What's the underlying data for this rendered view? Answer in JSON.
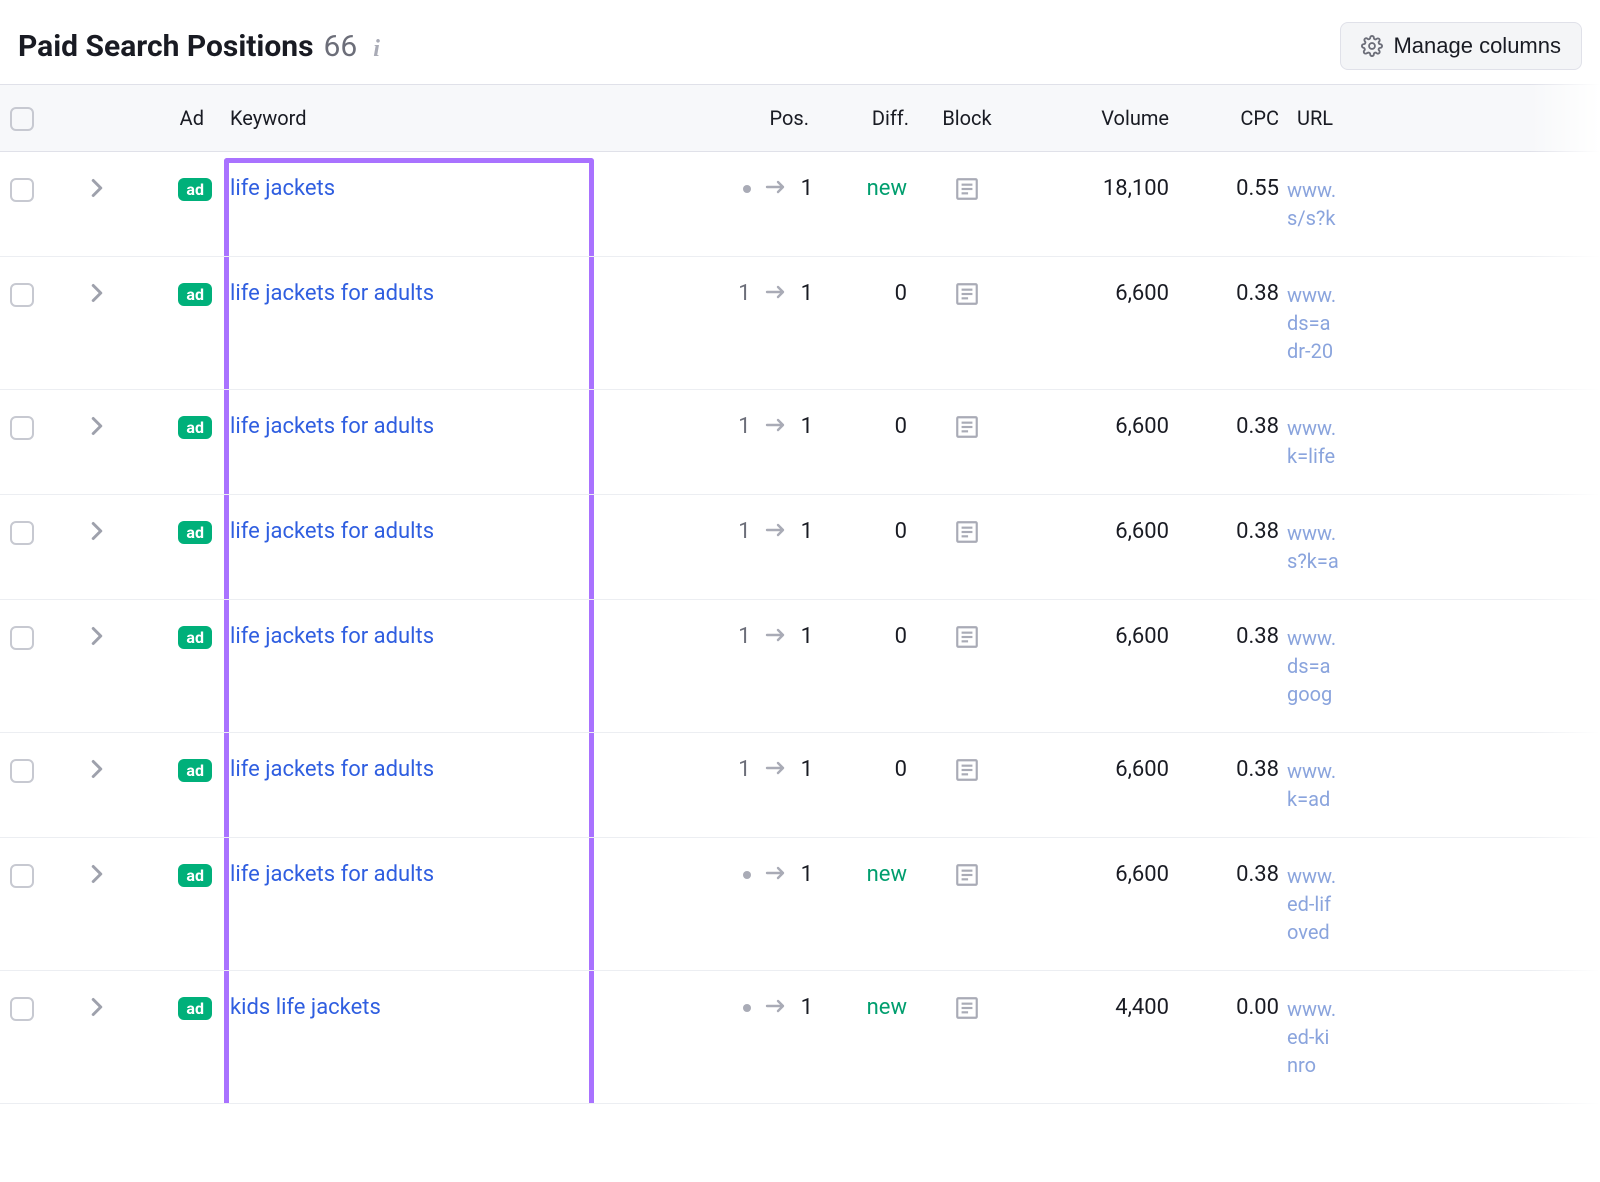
{
  "header": {
    "title": "Paid Search Positions",
    "count": "66",
    "manage_label": "Manage columns"
  },
  "columns": {
    "ad": "Ad",
    "keyword": "Keyword",
    "pos": "Pos.",
    "diff": "Diff.",
    "block": "Block",
    "volume": "Volume",
    "cpc": "CPC",
    "url": "URL"
  },
  "rows": [
    {
      "keyword": "life jackets",
      "pos_from": null,
      "pos_to": "1",
      "diff": "new",
      "volume": "18,100",
      "cpc": "0.55",
      "url": "www.\ns/s?k"
    },
    {
      "keyword": "life jackets for adults",
      "pos_from": "1",
      "pos_to": "1",
      "diff": "0",
      "volume": "6,600",
      "cpc": "0.38",
      "url": "www.\nds=a\ndr-20"
    },
    {
      "keyword": "life jackets for adults",
      "pos_from": "1",
      "pos_to": "1",
      "diff": "0",
      "volume": "6,600",
      "cpc": "0.38",
      "url": "www.\nk=life"
    },
    {
      "keyword": "life jackets for adults",
      "pos_from": "1",
      "pos_to": "1",
      "diff": "0",
      "volume": "6,600",
      "cpc": "0.38",
      "url": "www.\ns?k=a"
    },
    {
      "keyword": "life jackets for adults",
      "pos_from": "1",
      "pos_to": "1",
      "diff": "0",
      "volume": "6,600",
      "cpc": "0.38",
      "url": "www.\nds=a\ngoog"
    },
    {
      "keyword": "life jackets for adults",
      "pos_from": "1",
      "pos_to": "1",
      "diff": "0",
      "volume": "6,600",
      "cpc": "0.38",
      "url": "www.\nk=ad"
    },
    {
      "keyword": "life jackets for adults",
      "pos_from": null,
      "pos_to": "1",
      "diff": "new",
      "volume": "6,600",
      "cpc": "0.38",
      "url": "www.\ned-lif\noved"
    },
    {
      "keyword": "kids life jackets",
      "pos_from": null,
      "pos_to": "1",
      "diff": "new",
      "volume": "4,400",
      "cpc": "0.00",
      "url": "www.\ned-ki\nnro"
    }
  ],
  "ad_badge_label": "ad"
}
